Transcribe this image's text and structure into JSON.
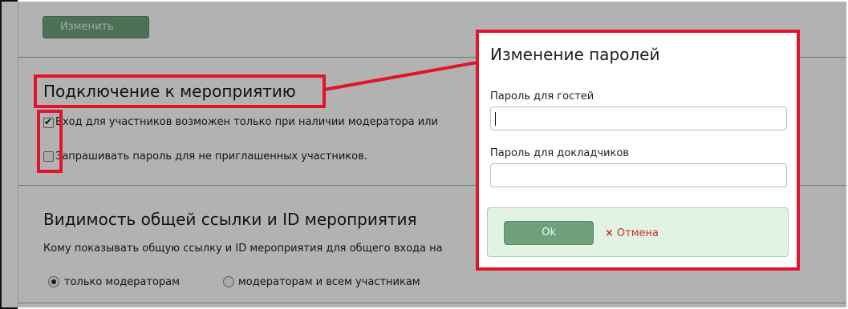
{
  "page": {
    "change_button": "Изменить",
    "connection_section": {
      "title": "Подключение к мероприятию",
      "option_moderator_required": "Вход для участников возможен только при наличии модератора или",
      "option_moderator_required_checked": true,
      "option_ask_password": "Запрашивать пароль для не приглашенных участников.",
      "option_ask_password_checked": false
    },
    "visibility_section": {
      "title": "Видимость общей ссылки и ID мероприятия",
      "description": "Кому показывать общую ссылку и ID мероприятия для общего входа на",
      "radio_moderators_only": "только модераторам",
      "radio_moderators_only_checked": true,
      "radio_all": "модераторам и всем участникам",
      "radio_all_checked": false
    }
  },
  "modal": {
    "title": "Изменение паролей",
    "guest_password_label": "Пароль для гостей",
    "guest_password_value": "",
    "speaker_password_label": "Пароль для докладчиков",
    "speaker_password_value": "",
    "ok_label": "Ok",
    "cancel_label": "Отмена",
    "cancel_icon": "×"
  },
  "annotation_color": "#e0142b",
  "accent_color": "#6ea07c"
}
